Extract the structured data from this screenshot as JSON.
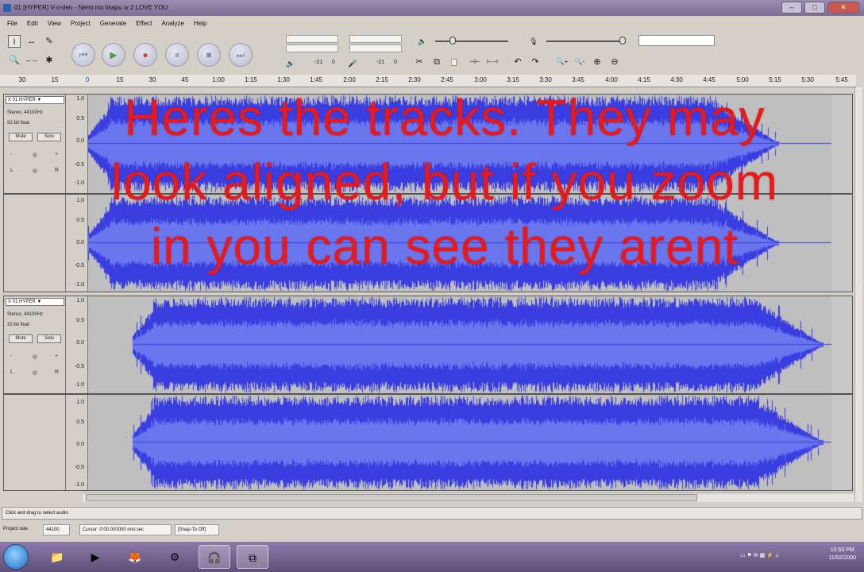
{
  "window": {
    "title": "01 [HYPER] V-o-den - Nemi mo lisapu w 2 LOVE YOU",
    "controls": [
      "–",
      "□",
      "✕"
    ]
  },
  "menu": [
    "File",
    "Edit",
    "View",
    "Project",
    "Generate",
    "Effect",
    "Analyze",
    "Help"
  ],
  "toolbar": {
    "tools": [
      "I",
      "↔",
      "✎",
      "🔍",
      "↔↔",
      "✱"
    ],
    "transport": [
      "⏮",
      "▶",
      "●",
      "⏸",
      "■",
      "⏭"
    ],
    "meter_scale_out": [
      "-21",
      "0"
    ],
    "meter_scale_in": [
      "-21",
      "0"
    ],
    "edit_tools": [
      "✂",
      "⧉",
      "📋",
      "⊣⊢",
      "⊢⊣",
      "↶",
      "↷",
      "🔍+",
      "🔍-",
      "⊕",
      "⊖"
    ]
  },
  "ruler": {
    "ticks": [
      "30",
      "15",
      "0",
      "15",
      "30",
      "45",
      "1:00",
      "1:15",
      "1:30",
      "1:45",
      "2:00",
      "2:15",
      "2:30",
      "2:45",
      "3:00",
      "3:15",
      "3:30",
      "3:45",
      "4:00",
      "4:15",
      "4:30",
      "4:45",
      "5:00",
      "5:15",
      "5:30",
      "5:45"
    ]
  },
  "tracks": [
    {
      "name": "X  01 HYPER  ▼",
      "info1": "Stereo, 44100Hz",
      "info2": "32-bit float",
      "mute": "Mute",
      "solo": "Solo",
      "gain_left": "-",
      "gain_right": "+",
      "pan_left": "L",
      "pan_right": "R",
      "scale": [
        "1.0",
        "0.5",
        "0.0",
        "-0.5",
        "-1.0"
      ]
    },
    {
      "name": "X  01 HYPER  ▼",
      "info1": "Stereo, 44100Hz",
      "info2": "32-bit float",
      "mute": "Mute",
      "solo": "Solo",
      "gain_left": "-",
      "gain_right": "+",
      "pan_left": "L",
      "pan_right": "R",
      "scale": [
        "1.0",
        "0.5",
        "0.0",
        "-0.5",
        "-1.0"
      ]
    }
  ],
  "overlay_text": "Heres the tracks. They may look aligned, but if you zoom in you can see they arent",
  "status": {
    "hint": "Click and drag to select audio",
    "project_rate_label": "Project rate:",
    "project_rate": "44100",
    "cursor": "Cursor: 0:00.000000 min:sec",
    "snap": "[Snap-To Off]"
  },
  "taskbar": {
    "icons": [
      "📁",
      "▶",
      "🦊",
      "⚙",
      "🎧",
      "⧉"
    ],
    "clock_time": "10:53 PM",
    "clock_date": "11/02/2000"
  },
  "colors": {
    "waveform": "#3a3ee0",
    "waveform_rms": "#6a76ee",
    "track_bg": "#bfbfbf",
    "overlay_text": "#e8191a"
  }
}
